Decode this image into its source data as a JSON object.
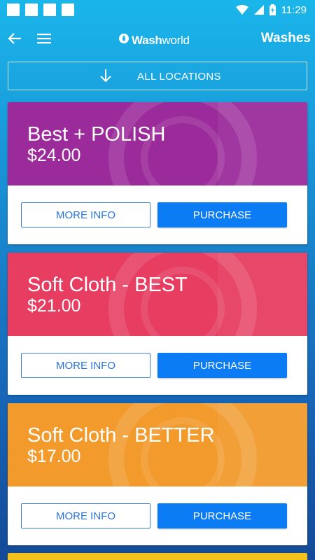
{
  "status_bar": {
    "time": "11:29"
  },
  "app_bar": {
    "logo_bold": "Wash",
    "logo_light": "world",
    "title": "Washes"
  },
  "location_filter": {
    "label": "ALL LOCATIONS"
  },
  "washes": [
    {
      "name": "Best + POLISH",
      "price": "$24.00",
      "color": "#9b2a9a",
      "more_info": "MORE INFO",
      "purchase": "PURCHASE"
    },
    {
      "name": "Soft Cloth - BEST",
      "price": "$21.00",
      "color": "#e63d61",
      "more_info": "MORE INFO",
      "purchase": "PURCHASE"
    },
    {
      "name": "Soft Cloth - BETTER",
      "price": "$17.00",
      "color": "#f29a2c",
      "more_info": "MORE INFO",
      "purchase": "PURCHASE"
    }
  ],
  "peek_color": "#f3c21b"
}
